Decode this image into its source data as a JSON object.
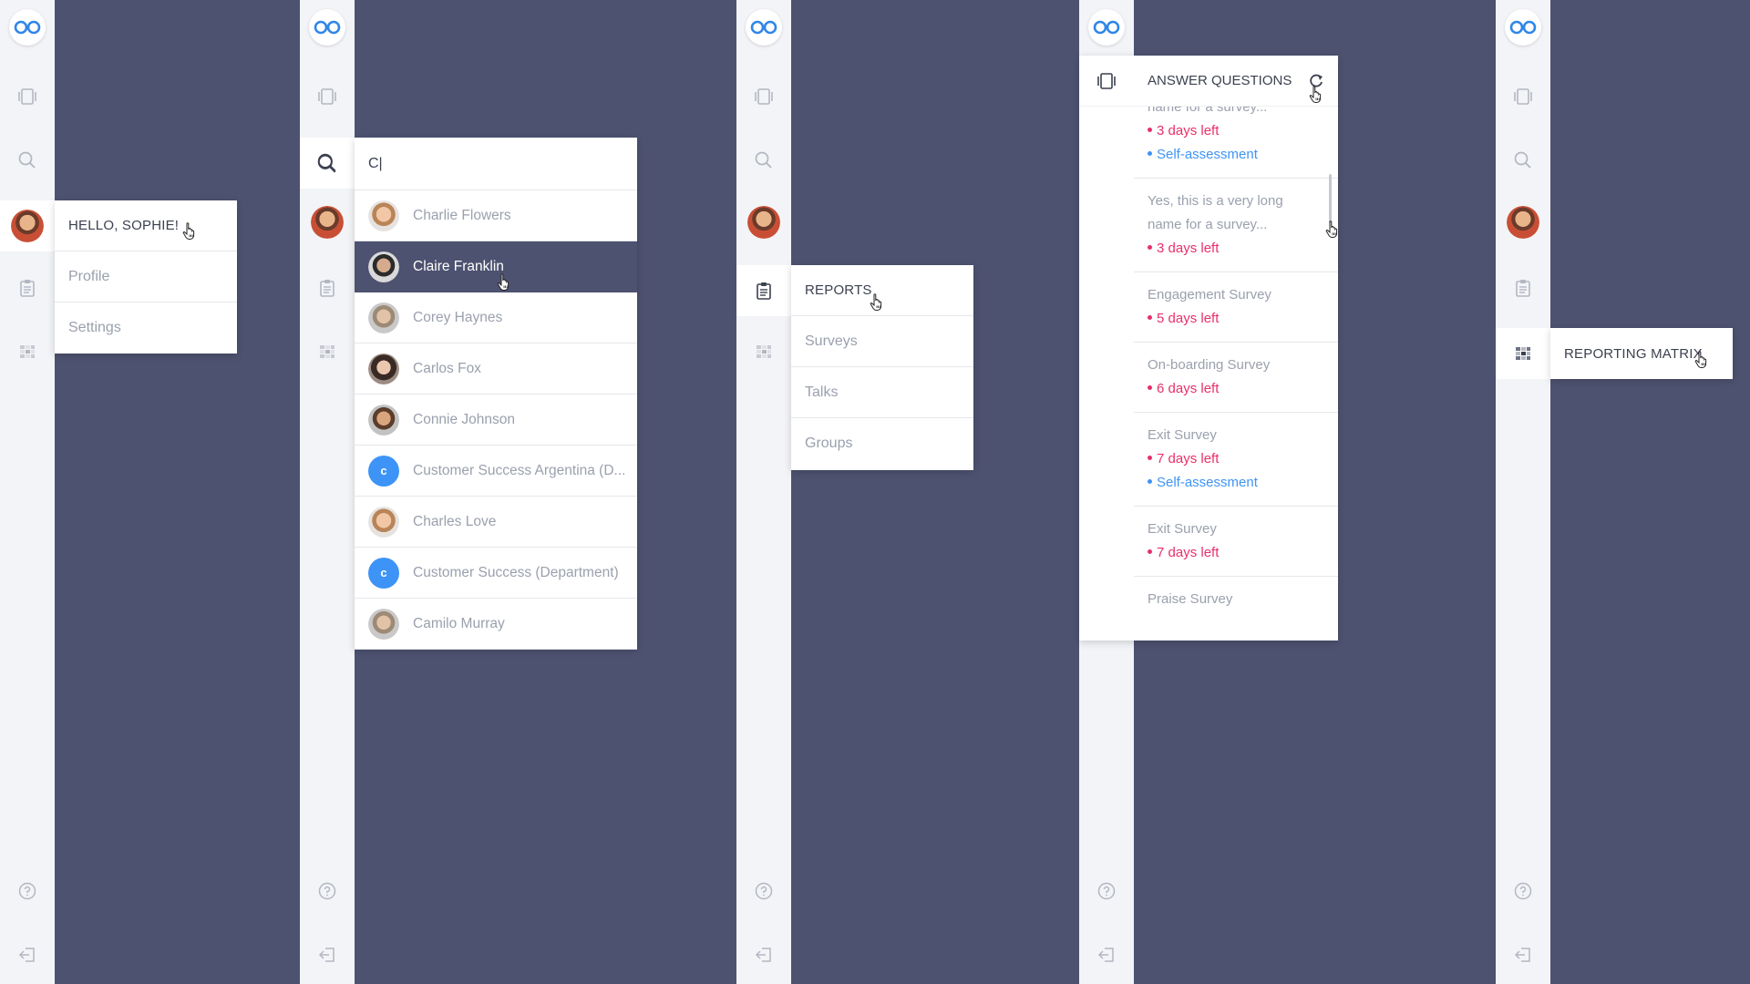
{
  "colors": {
    "background": "#4d5270",
    "rail": "#f3f4f7",
    "accent_blue": "#3d94f6",
    "due_pink": "#e8306a",
    "selected_row": "#4d5270"
  },
  "icons": {
    "logo": "infinity-logo-icon",
    "feed": "cards-stack-icon",
    "search": "search-icon",
    "reports": "clipboard-icon",
    "matrix": "matrix-grid-icon",
    "help": "help-circle-icon",
    "logout": "logout-icon",
    "refresh": "refresh-icon",
    "cursor": "hand-pointer-icon"
  },
  "panel1": {
    "greeting": "HELLO, SOPHIE!",
    "items": [
      "Profile",
      "Settings"
    ]
  },
  "panel2": {
    "query": "C|",
    "results": [
      {
        "name": "Charlie Flowers",
        "type": "avatar"
      },
      {
        "name": "Claire Franklin",
        "type": "avatar",
        "selected": true
      },
      {
        "name": "Corey Haynes",
        "type": "avatar"
      },
      {
        "name": "Carlos Fox",
        "type": "avatar"
      },
      {
        "name": "Connie Johnson",
        "type": "avatar"
      },
      {
        "name": "Customer Success Argentina (D...",
        "type": "letter",
        "letter": "c"
      },
      {
        "name": "Charles Love",
        "type": "avatar"
      },
      {
        "name": "Customer Success (Department)",
        "type": "letter",
        "letter": "c"
      },
      {
        "name": "Camilo Murray",
        "type": "avatar"
      }
    ]
  },
  "panel3": {
    "title": "REPORTS",
    "items": [
      "Surveys",
      "Talks",
      "Groups"
    ]
  },
  "panel4": {
    "title": "ANSWER QUESTIONS",
    "partial_top_name": "name for a survey...",
    "partial_top_due": "3 days left",
    "partial_top_tag": "Self-assessment",
    "items": [
      {
        "name": "Yes, this is a very long name for a survey...",
        "due": "3 days left"
      },
      {
        "name": "Engagement Survey",
        "due": "5 days left"
      },
      {
        "name": "On-boarding Survey",
        "due": "6 days left"
      },
      {
        "name": "Exit Survey",
        "due": "7 days left",
        "tag": "Self-assessment"
      },
      {
        "name": "Exit Survey",
        "due": "7 days left"
      }
    ],
    "partial_bottom_name": "Praise Survey"
  },
  "panel5": {
    "title": "REPORTING MATRIX"
  }
}
